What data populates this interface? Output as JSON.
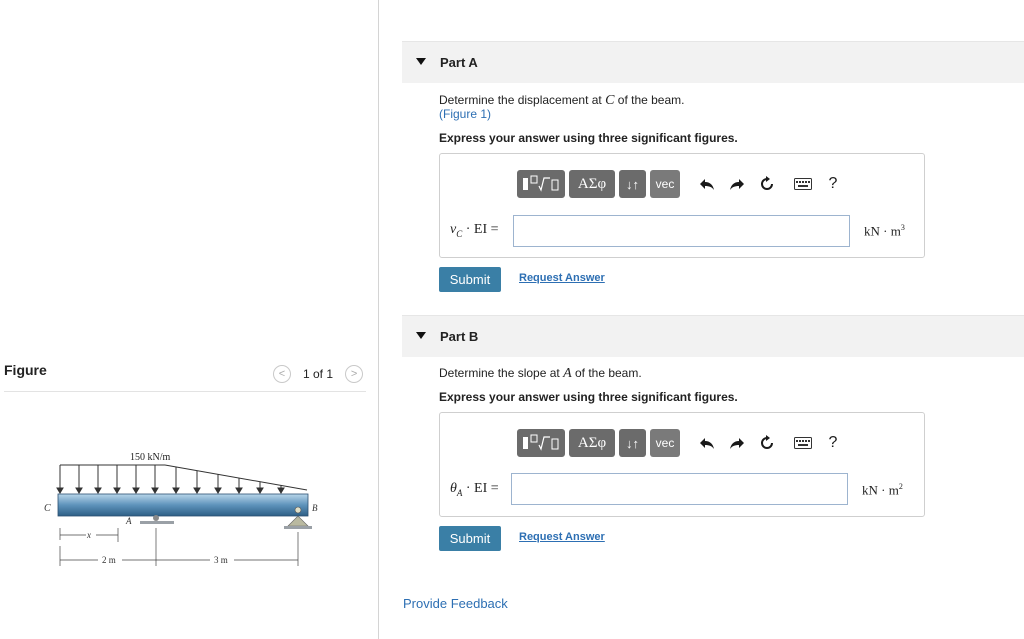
{
  "figure": {
    "title": "Figure",
    "pager": "1 of 1",
    "prev_icon": "chevron-left-icon",
    "next_icon": "chevron-right-icon",
    "labels": {
      "load": "150 kN/m",
      "point_c": "C",
      "point_a": "A",
      "point_b": "B",
      "x": "x",
      "dim1": "2 m",
      "dim2": "3 m"
    }
  },
  "toolbar": {
    "greek": "ΑΣφ",
    "updown": "↓↑",
    "vec": "vec",
    "help": "?",
    "icons": [
      "templates-icon",
      "greek-icon",
      "subscript-icon",
      "vec-icon",
      "undo-icon",
      "redo-icon",
      "reset-icon",
      "keyboard-icon",
      "help-icon"
    ]
  },
  "part_a": {
    "title": "Part A",
    "question_pre": "Determine the displacement at ",
    "question_var": "C",
    "question_post": " of the beam.",
    "figure_link": "(Figure 1)",
    "instruction": "Express your answer using three significant figures.",
    "eq_var": "v",
    "eq_sub": "C",
    "eq_rest": " · EI =",
    "unit": "kN · m",
    "unit_exp": "3",
    "input_value": "",
    "submit": "Submit",
    "request": "Request Answer"
  },
  "part_b": {
    "title": "Part B",
    "question_pre": "Determine the slope at ",
    "question_var": "A",
    "question_post": " of the beam.",
    "instruction": "Express your answer using three significant figures.",
    "eq_var": "θ",
    "eq_sub": "A",
    "eq_rest": " · EI =",
    "unit": "kN · m",
    "unit_exp": "2",
    "input_value": "",
    "submit": "Submit",
    "request": "Request Answer"
  },
  "feedback": "Provide Feedback"
}
